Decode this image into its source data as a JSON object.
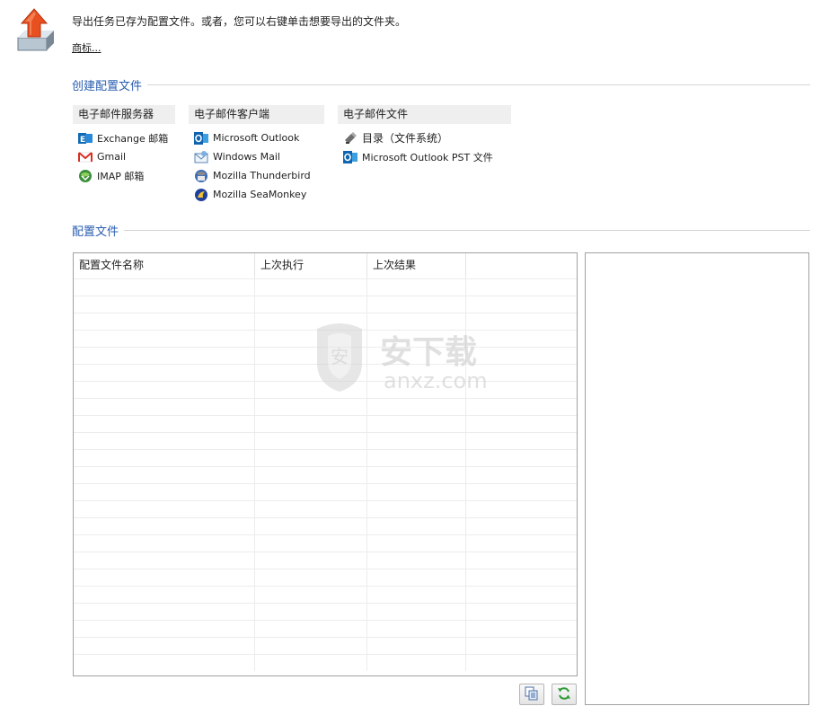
{
  "header": {
    "intro": "导出任务已存为配置文件。或者，您可以右键单击想要导出的文件夹。",
    "more_link": "商标..."
  },
  "create_section": {
    "title": "创建配置文件"
  },
  "groups": [
    {
      "header": "电子邮件服务器",
      "items": [
        {
          "label": "Exchange 邮箱",
          "icon": "exchange-icon"
        },
        {
          "label": "Gmail",
          "icon": "gmail-icon"
        },
        {
          "label": "IMAP 邮箱",
          "icon": "imap-globe-icon"
        }
      ]
    },
    {
      "header": "电子邮件客户端",
      "items": [
        {
          "label": "Microsoft Outlook",
          "icon": "outlook-icon"
        },
        {
          "label": "Windows Mail",
          "icon": "windows-mail-icon"
        },
        {
          "label": "Mozilla Thunderbird",
          "icon": "thunderbird-icon"
        },
        {
          "label": "Mozilla SeaMonkey",
          "icon": "seamonkey-icon"
        }
      ]
    },
    {
      "header": "电子邮件文件",
      "items": [
        {
          "label": "目录（文件系统）",
          "icon": "directory-icon"
        },
        {
          "label": "Microsoft Outlook PST 文件",
          "icon": "outlook-pst-icon"
        }
      ]
    }
  ],
  "profiles_section": {
    "title": "配置文件",
    "columns": [
      "配置文件名称",
      "上次执行",
      "上次结果",
      ""
    ]
  },
  "toolbar": {
    "copy_icon": "copy-icon",
    "refresh_icon": "refresh-icon"
  },
  "watermark": {
    "cn": "安下载",
    "en": "anxz.com"
  },
  "colors": {
    "section_title": "#2a5db0",
    "group_header_bg": "#efefef",
    "border": "#a0a0a0"
  }
}
